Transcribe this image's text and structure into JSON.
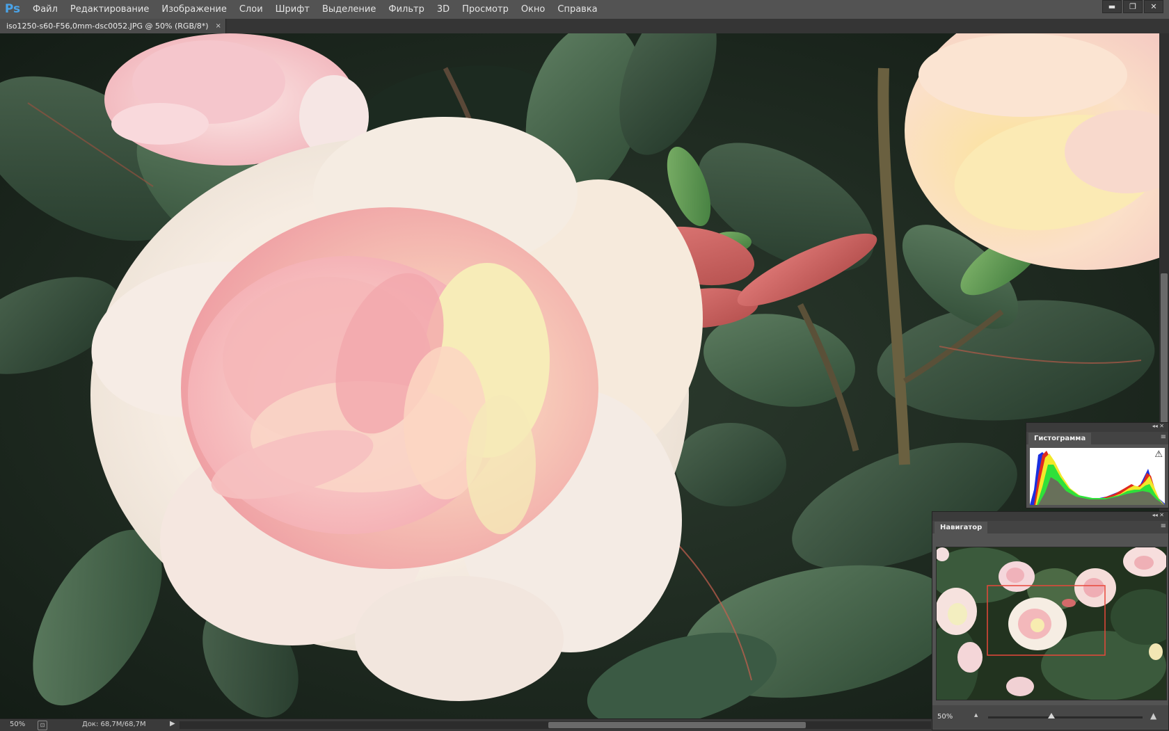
{
  "app": {
    "logo_text": "Ps"
  },
  "menu": {
    "items": [
      "Файл",
      "Редактирование",
      "Изображение",
      "Слои",
      "Шрифт",
      "Выделение",
      "Фильтр",
      "3D",
      "Просмотр",
      "Окно",
      "Справка"
    ]
  },
  "window_controls": {
    "minimize": "▬",
    "restore": "❐",
    "close": "✕"
  },
  "document": {
    "tab_title": "iso1250-s60-F56,0mm-dsc0052.JPG @ 50% (RGB/8*)",
    "tab_close": "×"
  },
  "status": {
    "zoom": "50%",
    "doc_info": "Док: 68,7M/68,7M",
    "arrow": "▶"
  },
  "panels": {
    "histogram": {
      "title": "Гистограмма",
      "collapse": "◂◂ ✕",
      "menu": "≡",
      "warning_icon": "⚠"
    },
    "navigator": {
      "title": "Навигатор",
      "collapse": "◂◂ ✕",
      "menu": "≡",
      "zoom": "50%",
      "zoom_out_icon": "▲",
      "zoom_in_icon": "▲"
    }
  },
  "icons": {
    "logo": "photoshop-logo",
    "status_icon": "document-status-icon",
    "warning": "warning-icon"
  },
  "colors": {
    "menubar": "#535353",
    "panel": "#535353",
    "accent": "#4aa3e8",
    "nav_view_box": "#e8473a"
  }
}
